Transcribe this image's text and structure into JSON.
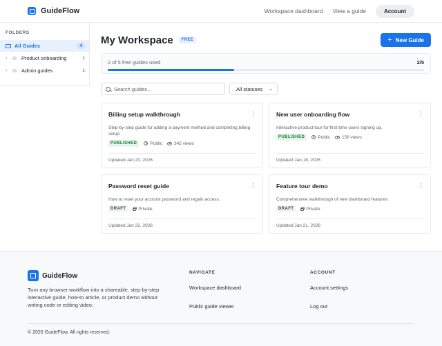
{
  "header": {
    "brand": "GuideFlow",
    "nav": [
      "Workspace dashboard",
      "View a guide"
    ],
    "account_label": "Account"
  },
  "sidebar": {
    "title": "FOLDERS",
    "items": [
      {
        "label": "All Guides",
        "count": "4",
        "active": true
      },
      {
        "label": "Product onboarding",
        "count": "1"
      },
      {
        "label": "Admin guides",
        "count": "1"
      }
    ]
  },
  "main": {
    "title": "My Workspace",
    "plan_badge": "FREE",
    "new_guide_label": "New Guide",
    "usage": {
      "text": "2 of 5 free guides used",
      "count": "2/5",
      "fraction": 0.4
    },
    "search_placeholder": "Search guides...",
    "status_filter": "All statuses"
  },
  "guides": [
    {
      "title": "Billing setup walkthrough",
      "description": "Step-by-step guide for adding a payment method and completing billing setup.",
      "status": "PUBLISHED",
      "visibility": "Public",
      "views": "342 views",
      "updated": "Updated Jan 20, 2026"
    },
    {
      "title": "New user onboarding flow",
      "description": "Interactive product tour for first-time users signing up.",
      "status": "PUBLISHED",
      "visibility": "Public",
      "views": "156 views",
      "updated": "Updated Jan 18, 2026"
    },
    {
      "title": "Password reset guide",
      "description": "How to reset your account password and regain access.",
      "status": "DRAFT",
      "visibility": "Private",
      "updated": "Updated Jan 22, 2026"
    },
    {
      "title": "Feature tour demo",
      "description": "Comprehensive walkthrough of new dashboard features.",
      "status": "DRAFT",
      "visibility": "Private",
      "updated": "Updated Jan 21, 2026"
    }
  ],
  "footer": {
    "brand": "GuideFlow",
    "description": "Turn any browser workflow into a shareable, step-by-step interactive guide, how-to article, or product demo without writing code or editing video.",
    "navigate_title": "NAVIGATE",
    "navigate_links": [
      "Workspace dashboard",
      "Public guide viewer"
    ],
    "account_title": "ACCOUNT",
    "account_links": [
      "Account settings",
      "Log out"
    ],
    "copyright": "© 2026 GuideFlow. All rights reserved."
  },
  "colors": {
    "accent": "#1a73e8",
    "published": "#188038"
  }
}
